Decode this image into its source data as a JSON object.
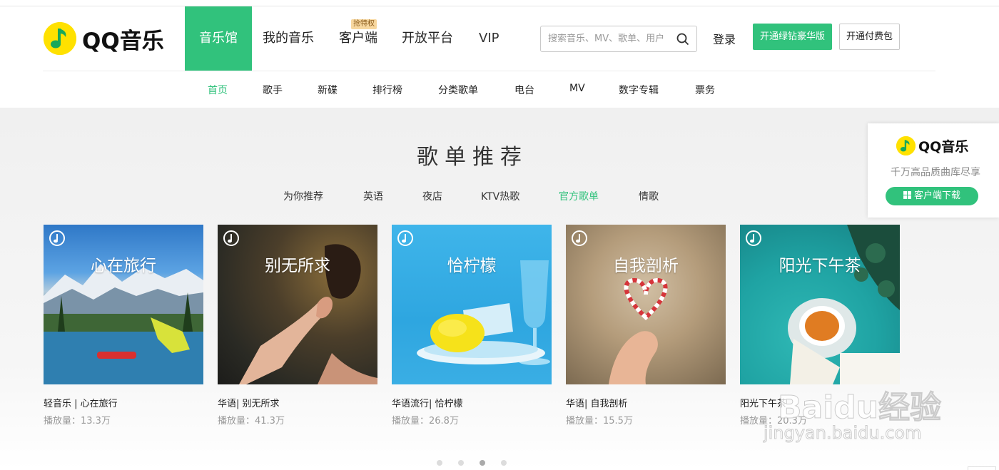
{
  "brand": {
    "name": "QQ音乐"
  },
  "main_nav": {
    "items": [
      {
        "label": "音乐馆",
        "active": true
      },
      {
        "label": "我的音乐"
      },
      {
        "label": "客户端",
        "badge": "抢特权"
      },
      {
        "label": "开放平台"
      },
      {
        "label": "VIP"
      }
    ]
  },
  "search": {
    "placeholder": "搜索音乐、MV、歌单、用户"
  },
  "header_actions": {
    "login_label": "登录",
    "green_button_label": "开通绿钻豪华版",
    "outline_button_label": "开通付费包"
  },
  "sub_nav": {
    "items": [
      "首页",
      "歌手",
      "新碟",
      "排行榜",
      "分类歌单",
      "电台",
      "MV",
      "数字专辑",
      "票务"
    ],
    "active_index": 0
  },
  "playlist_section": {
    "title": "歌单推荐",
    "tabs": [
      "为你推荐",
      "英语",
      "夜店",
      "KTV热歌",
      "官方歌单",
      "情歌"
    ],
    "active_tab_index": 4,
    "cards": [
      {
        "cover_title": "心在旅行",
        "name": "轻音乐 | 心在旅行",
        "plays": "播放量：13.3万"
      },
      {
        "cover_title": "别无所求",
        "name": "华语| 别无所求",
        "plays": "播放量：41.3万"
      },
      {
        "cover_title": "恰柠檬",
        "name": "华语流行| 恰柠檬",
        "plays": "播放量：26.8万"
      },
      {
        "cover_title": "自我剖析",
        "name": "华语| 自我剖析",
        "plays": "播放量：15.5万"
      },
      {
        "cover_title": "阳光下午茶",
        "name": "阳光下午茶",
        "plays": "播放量：20.3万"
      }
    ],
    "pagination": {
      "count": 4,
      "active_index": 2
    }
  },
  "promo": {
    "brand": "QQ音乐",
    "slogan": "千万高品质曲库尽享",
    "button_label": "客户端下载"
  },
  "watermark": {
    "main": "Baidu经验",
    "sub": "jingyan.baidu.com"
  },
  "colors": {
    "accent": "#31c27c",
    "logo_yellow": "#ffe100"
  }
}
